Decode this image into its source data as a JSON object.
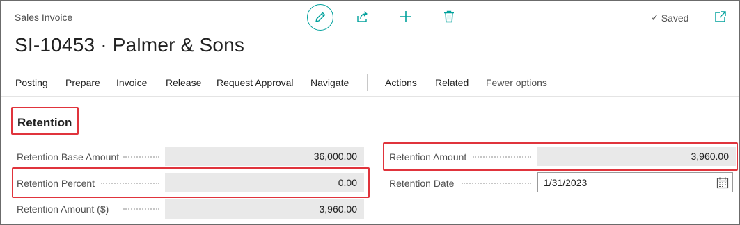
{
  "header": {
    "page_kind": "Sales Invoice",
    "title": "SI-10453 · Palmer & Sons",
    "status": "Saved",
    "status_check": "✓"
  },
  "toolbar": {
    "edit_icon": "pencil-icon",
    "share_icon": "share-icon",
    "new_icon": "plus-icon",
    "delete_icon": "trash-icon",
    "open_icon": "open-in-new-window-icon"
  },
  "actions": [
    {
      "label": "Posting"
    },
    {
      "label": "Prepare"
    },
    {
      "label": "Invoice"
    },
    {
      "label": "Release"
    },
    {
      "label": "Request Approval"
    },
    {
      "label": "Navigate"
    },
    {
      "label": "Actions"
    },
    {
      "label": "Related"
    },
    {
      "label": "Fewer options"
    }
  ],
  "section": {
    "title": "Retention"
  },
  "fields": {
    "retention_base_amount": {
      "label": "Retention Base Amount",
      "value": "36,000.00"
    },
    "retention_percent": {
      "label": "Retention Percent",
      "value": "0.00"
    },
    "retention_amount_currency": {
      "label": "Retention Amount ($)",
      "value": "3,960.00"
    },
    "retention_amount": {
      "label": "Retention Amount",
      "value": "3,960.00"
    },
    "retention_date": {
      "label": "Retention Date",
      "value": "1/31/2023"
    }
  },
  "colors": {
    "accent": "#00a19c",
    "highlight": "#e0343c",
    "readonly_field": "#e9e9e9"
  }
}
